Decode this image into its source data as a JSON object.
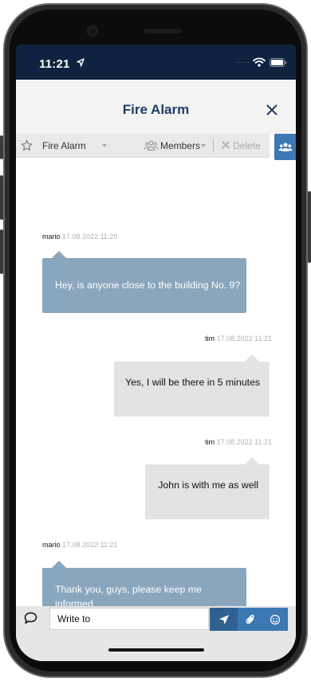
{
  "status_bar": {
    "time": "11:21",
    "signal_dots": "....."
  },
  "header": {
    "title": "Fire Alarm"
  },
  "toolbar": {
    "group_label": "Fire Alarm",
    "members_label": "Members",
    "delete_label": "Delete"
  },
  "messages": [
    {
      "author": "mario",
      "timestamp": "17.08.2022 11:20",
      "text": "Hey, is anyone close to the building No. 9?",
      "direction": "incoming"
    },
    {
      "author": "tim",
      "timestamp": "17.08.2022 11:21",
      "text": "Yes, I will be there in 5 minutes",
      "direction": "outgoing"
    },
    {
      "author": "tim",
      "timestamp": "17.08.2022 11:21",
      "text": "John is with me as well",
      "direction": "outgoing"
    },
    {
      "author": "mario",
      "timestamp": "17.08.2022 11:21",
      "text": "Thank you, guys, please keep me informed",
      "direction": "incoming"
    }
  ],
  "compose": {
    "placeholder": "Write to"
  },
  "icons": {
    "location": "location-arrow-icon",
    "wifi": "wifi-icon",
    "battery": "battery-icon",
    "close": "close-icon",
    "star": "star-icon",
    "members": "members-icon",
    "delete": "delete-x-icon",
    "people": "people-icon",
    "chat": "chat-bubble-icon",
    "send": "send-icon",
    "attach": "paperclip-icon",
    "emoji": "smiley-icon"
  },
  "colors": {
    "status_bar": "#0f2340",
    "title": "#1e3e64",
    "incoming_bubble": "#8aa6bd",
    "outgoing_bubble": "#e3e3e3",
    "accent_blue": "#3b78b4",
    "send_button": "#2f6190"
  }
}
